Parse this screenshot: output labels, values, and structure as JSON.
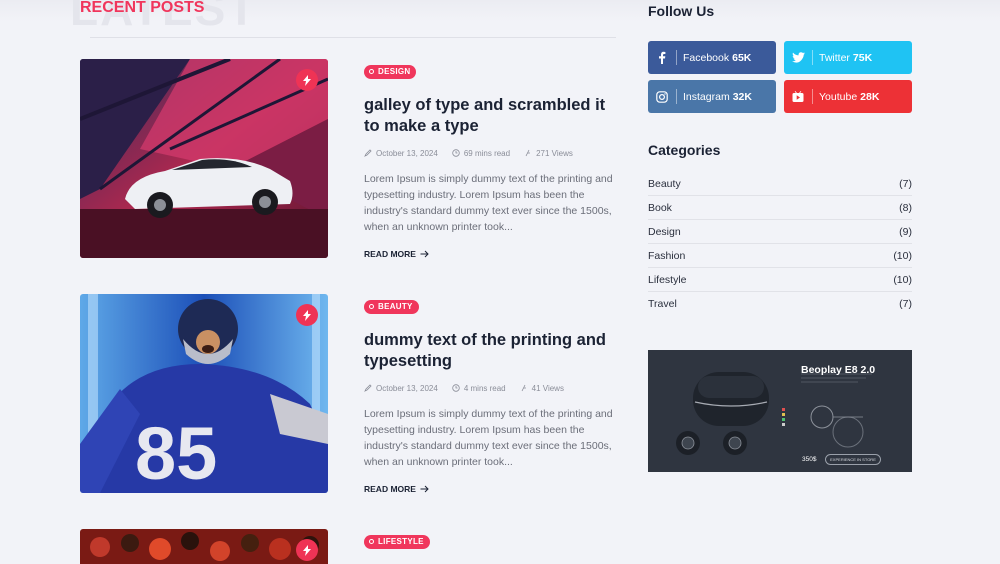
{
  "section": {
    "bg_heading": "LATEST",
    "title": "RECENT POSTS"
  },
  "posts": [
    {
      "category": "DESIGN",
      "title": "galley of type and scrambled it to make a type",
      "date": "October 13, 2024",
      "read_time": "69 mins read",
      "views": "271 Views",
      "excerpt": "Lorem Ipsum is simply dummy text of the printing and typesetting industry. Lorem Ipsum has been the industry's standard dummy text ever since the 1500s, when an unknown printer took...",
      "read_more": "READ MORE"
    },
    {
      "category": "BEAUTY",
      "title": "dummy text of the printing and typesetting",
      "date": "October 13, 2024",
      "read_time": "4 mins read",
      "views": "41 Views",
      "excerpt": "Lorem Ipsum is simply dummy text of the printing and typesetting industry. Lorem Ipsum has been the industry's standard dummy text ever since the 1500s, when an unknown printer took...",
      "read_more": "READ MORE"
    },
    {
      "category": "LIFESTYLE"
    }
  ],
  "sidebar": {
    "follow_title": "Follow Us",
    "social": [
      {
        "name": "Facebook",
        "count": "65K",
        "color": "#3b5a9a",
        "icon": "facebook-icon"
      },
      {
        "name": "Twitter",
        "count": "75K",
        "color": "#1fc3f3",
        "icon": "twitter-icon"
      },
      {
        "name": "Instagram",
        "count": "32K",
        "color": "#4a76a8",
        "icon": "instagram-icon"
      },
      {
        "name": "Youtube",
        "count": "28K",
        "color": "#ed3136",
        "icon": "youtube-icon"
      }
    ],
    "categories_title": "Categories",
    "categories": [
      {
        "name": "Beauty",
        "count": "(7)"
      },
      {
        "name": "Book",
        "count": "(8)"
      },
      {
        "name": "Design",
        "count": "(9)"
      },
      {
        "name": "Fashion",
        "count": "(10)"
      },
      {
        "name": "Lifestyle",
        "count": "(10)"
      },
      {
        "name": "Travel",
        "count": "(7)"
      }
    ],
    "ad": {
      "title": "Beoplay E8 2.0",
      "price": "350$",
      "button": "EXPERIENCE IN STORE"
    }
  },
  "colors": {
    "accent": "#f0365c",
    "background": "#f2f3f8",
    "text": "#1b2234"
  }
}
